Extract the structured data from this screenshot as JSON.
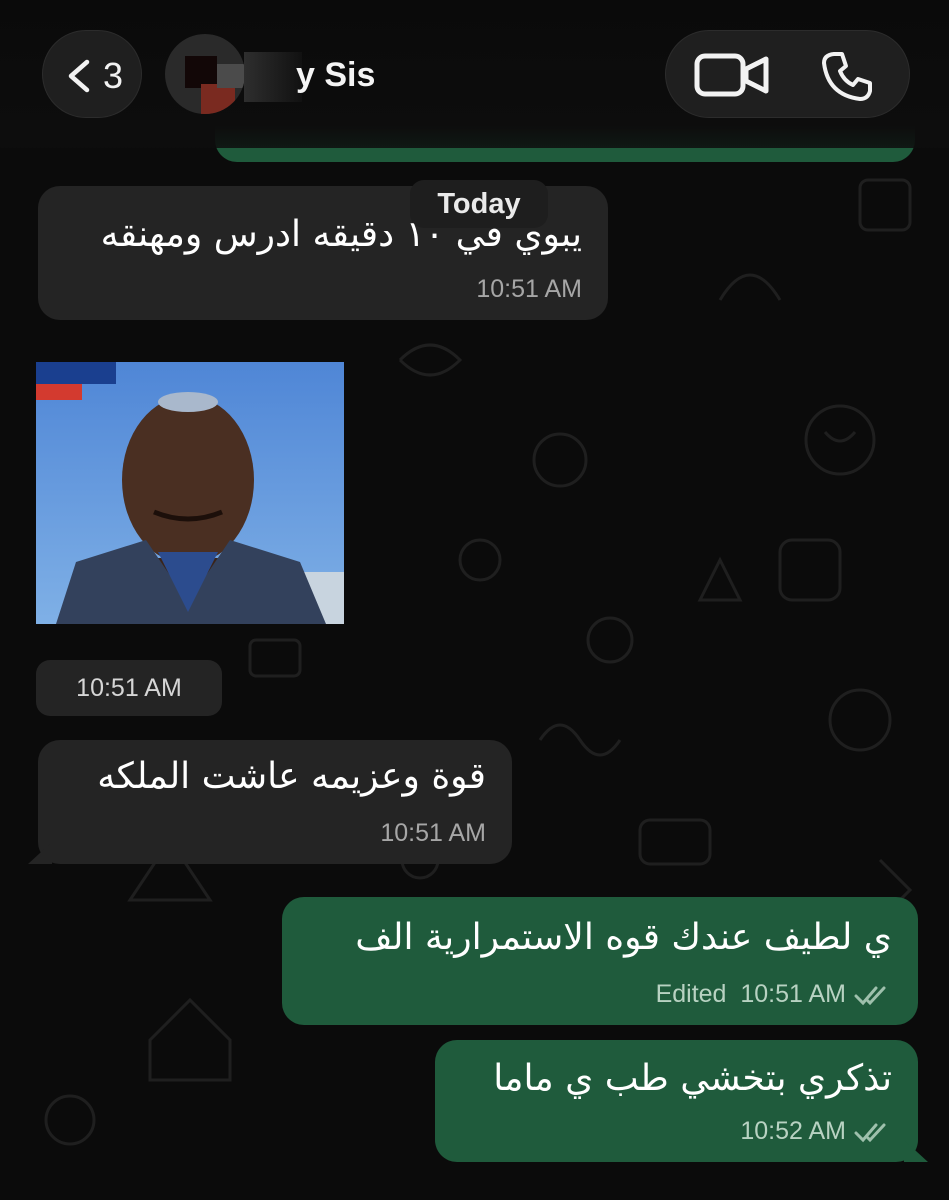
{
  "header": {
    "back_count": "3",
    "contact_name": "y Sis"
  },
  "date_chip": "Today",
  "messages": [
    {
      "type": "text",
      "direction": "incoming",
      "text": "يبوي في ١٠ دقيقه ادرس ومهنقه",
      "time": "10:51 AM"
    },
    {
      "type": "image",
      "direction": "incoming",
      "time": "10:51 AM"
    },
    {
      "type": "text",
      "direction": "incoming",
      "text": "قوة وعزيمه عاشت الملكه",
      "time": "10:51 AM"
    },
    {
      "type": "text",
      "direction": "outgoing",
      "text": "ي لطيف عندك قوه الاستمرارية الف",
      "edited": "Edited",
      "time": "10:51 AM",
      "status": "read"
    },
    {
      "type": "text",
      "direction": "outgoing",
      "text": "تذكري بتخشي طب ي ماما",
      "time": "10:52 AM",
      "status": "read"
    }
  ],
  "colors": {
    "background": "#0b0b0b",
    "incoming_bubble": "#242424",
    "outgoing_bubble": "#1f5b3c",
    "check_color": "#9ec0ac"
  },
  "icons": {
    "back": "chevron-left-icon",
    "video": "video-camera-icon",
    "call": "phone-icon",
    "read": "double-check-icon"
  }
}
